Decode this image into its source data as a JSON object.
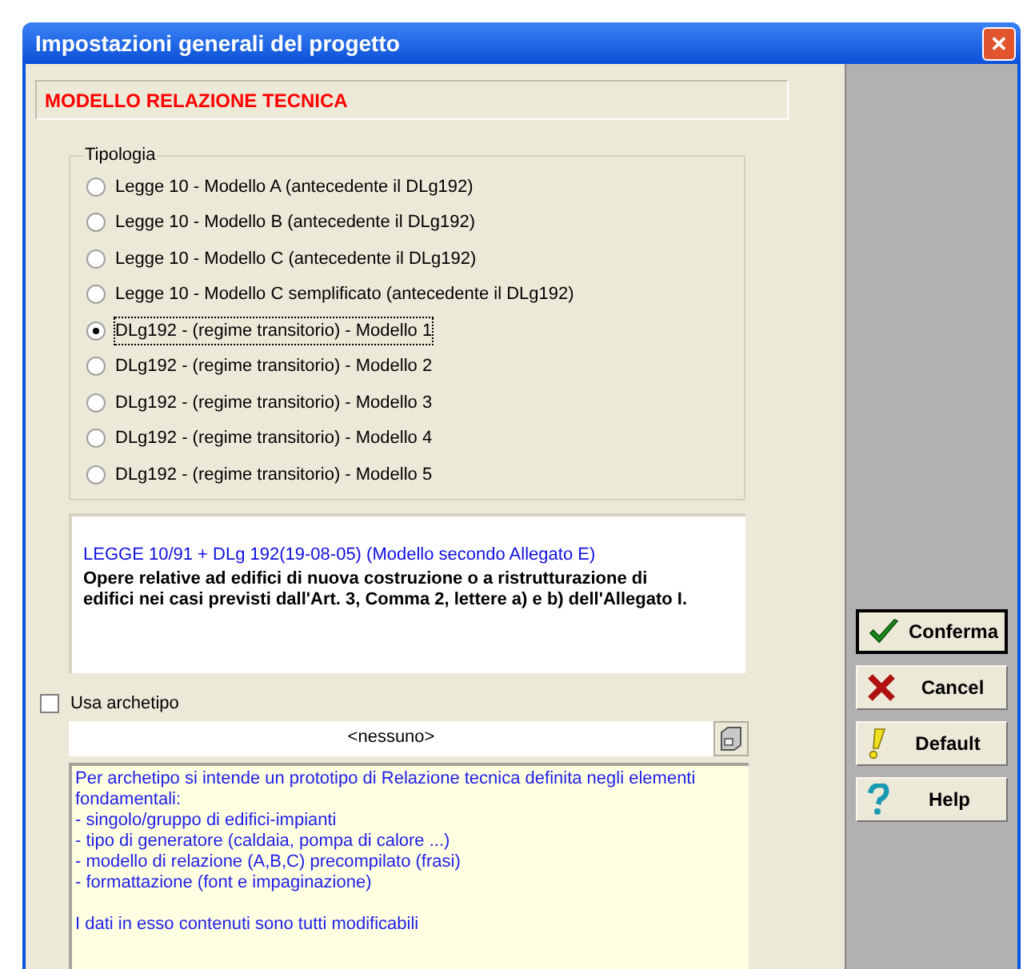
{
  "window": {
    "title": "Impostazioni generali del progetto",
    "close": "✕"
  },
  "header": "MODELLO RELAZIONE TECNICA",
  "tipologia": {
    "legend": "Tipologia",
    "options": [
      {
        "label": "Legge 10 - Modello A (antecedente il DLg192)",
        "selected": false
      },
      {
        "label": "Legge 10 - Modello B (antecedente il DLg192)",
        "selected": false
      },
      {
        "label": "Legge 10 - Modello C (antecedente il DLg192)",
        "selected": false
      },
      {
        "label": "Legge 10 - Modello C semplificato (antecedente il DLg192)",
        "selected": false
      },
      {
        "label": "DLg192 - (regime transitorio) - Modello 1",
        "selected": true
      },
      {
        "label": "DLg192 - (regime transitorio) - Modello 2",
        "selected": false
      },
      {
        "label": "DLg192 - (regime transitorio) - Modello 3",
        "selected": false
      },
      {
        "label": "DLg192 - (regime transitorio) - Modello 4",
        "selected": false
      },
      {
        "label": "DLg192 - (regime transitorio) - Modello 5",
        "selected": false
      }
    ]
  },
  "description": {
    "reference": "LEGGE 10/91 + DLg 192(19-08-05) (Modello secondo Allegato E)",
    "text": "Opere relative ad edifici di nuova costruzione o a ristrutturazione di edifici nei casi previsti dall'Art. 3, Comma 2, lettere a) e b) dell'Allegato I."
  },
  "archetype": {
    "label": "Usa archetipo",
    "checked": false,
    "value": "<nessuno>"
  },
  "note": {
    "lines": [
      "Per archetipo si intende un prototipo di Relazione tecnica definita negli elementi fondamentali:",
      "- singolo/gruppo di edifici-impianti",
      "- tipo di generatore (caldaia, pompa di calore ...)",
      "- modello di relazione (A,B,C) precompilato (frasi)",
      "- formattazione (font e impaginazione)"
    ],
    "footer": "I dati in esso contenuti sono tutti modificabili"
  },
  "buttons": [
    {
      "label": "Conferma",
      "kind": "confirm",
      "default": true
    },
    {
      "label": "Cancel",
      "kind": "cancel",
      "default": false
    },
    {
      "label": "Default",
      "kind": "default",
      "default": false
    },
    {
      "label": "Help",
      "kind": "help",
      "default": false
    }
  ]
}
